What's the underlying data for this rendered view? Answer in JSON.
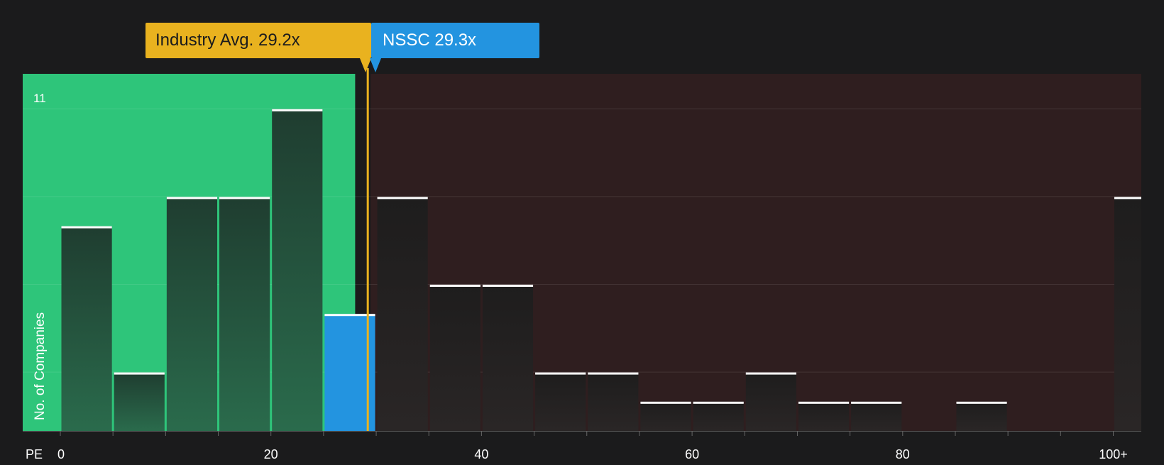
{
  "chart_data": {
    "type": "bar",
    "title": "",
    "xlabel": "PE",
    "ylabel": "No. of Companies",
    "y_max_label": "11",
    "ylim": [
      0,
      11.5
    ],
    "bin_width": 5,
    "bins": [
      {
        "x0": 0,
        "count": 7
      },
      {
        "x0": 5,
        "count": 2
      },
      {
        "x0": 10,
        "count": 8
      },
      {
        "x0": 15,
        "count": 8
      },
      {
        "x0": 20,
        "count": 11
      },
      {
        "x0": 25,
        "count": 4,
        "highlight": true
      },
      {
        "x0": 30,
        "count": 8
      },
      {
        "x0": 35,
        "count": 5
      },
      {
        "x0": 40,
        "count": 5
      },
      {
        "x0": 45,
        "count": 2
      },
      {
        "x0": 50,
        "count": 2
      },
      {
        "x0": 55,
        "count": 1
      },
      {
        "x0": 60,
        "count": 1
      },
      {
        "x0": 65,
        "count": 2
      },
      {
        "x0": 70,
        "count": 1
      },
      {
        "x0": 75,
        "count": 1
      },
      {
        "x0": 85,
        "count": 1
      },
      {
        "x0": 100,
        "count": 8
      }
    ],
    "x_ticks": [
      {
        "value": 0,
        "label": "0"
      },
      {
        "value": 20,
        "label": "20"
      },
      {
        "value": 40,
        "label": "40"
      },
      {
        "value": 60,
        "label": "60"
      },
      {
        "value": 80,
        "label": "80"
      },
      {
        "value": 100,
        "label": "100+"
      }
    ],
    "industry_avg": {
      "value": 29.2,
      "label": "Industry Avg. 29.2x"
    },
    "company": {
      "value": 29.3,
      "ticker": "NSSC",
      "label": "NSSC 29.3x"
    },
    "colors": {
      "background": "#1b1b1c",
      "fair_zone": "#2ec57a",
      "expensive_zone": "#2f1e1f",
      "bar_in_fair_zone": "#22493a",
      "bar_default": "#232121",
      "company_bar": "#2394e0",
      "industry_line": "#e9b21f",
      "bar_cap": "#ffffff"
    }
  }
}
